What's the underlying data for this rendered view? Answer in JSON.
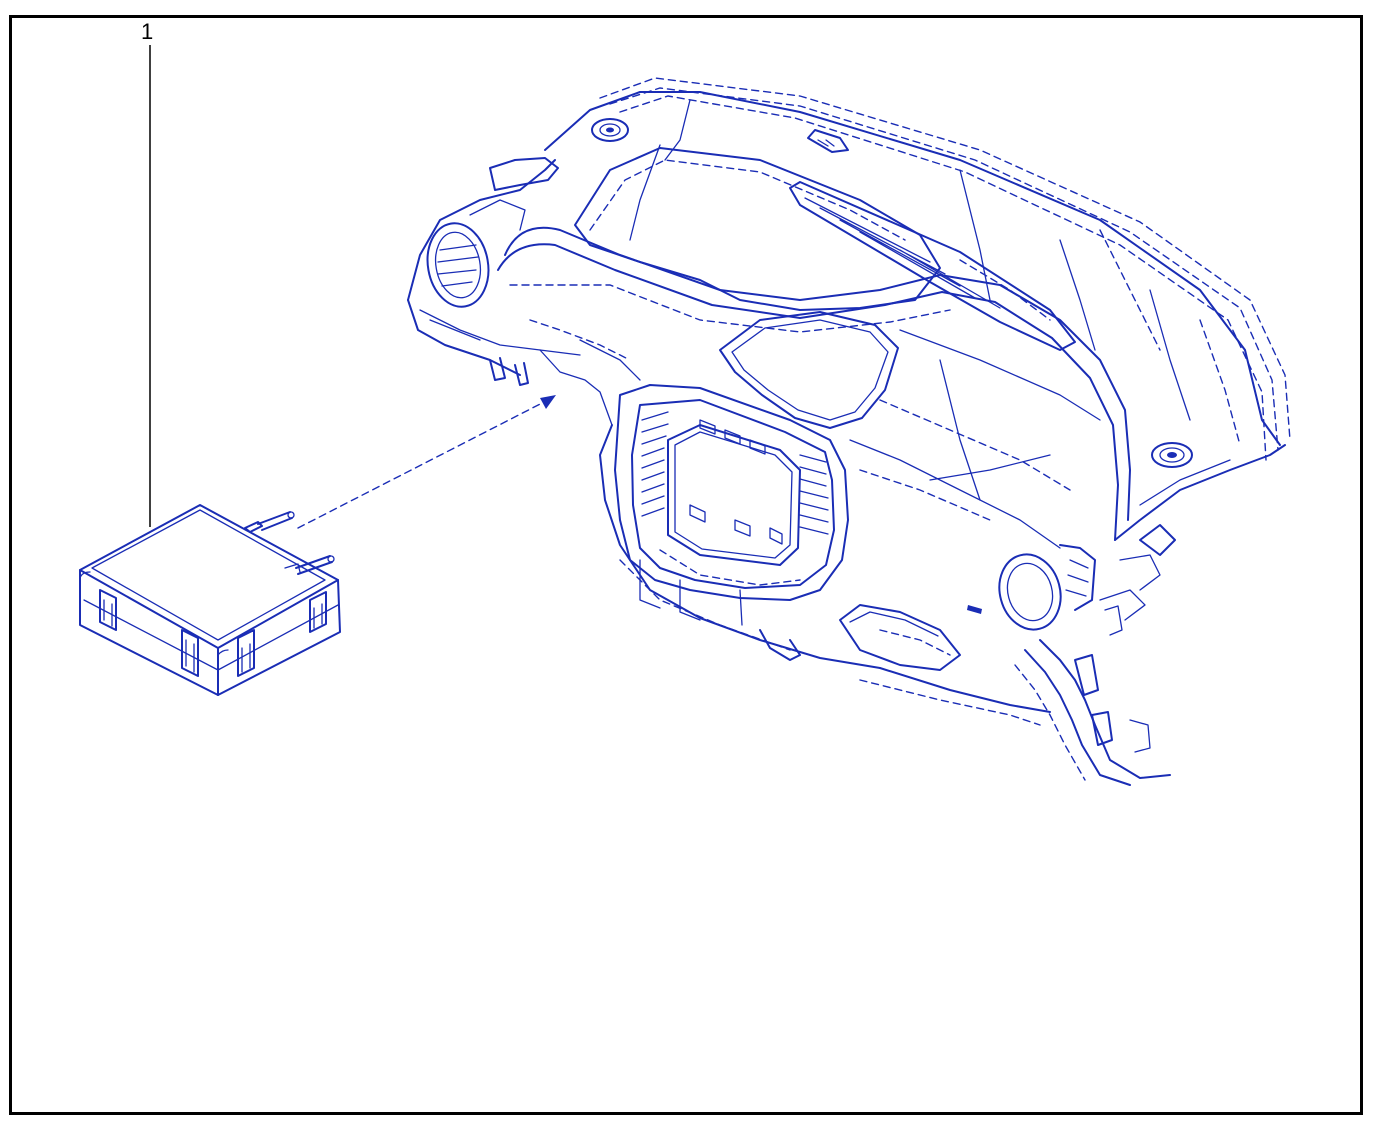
{
  "diagram": {
    "callouts": [
      {
        "number": "1",
        "part_icon": "airbag-module-icon"
      }
    ],
    "assembly_icon": "dashboard-assembly-icon",
    "colors": {
      "line": "#1a2db5",
      "frame": "#000000",
      "background": "#ffffff"
    }
  }
}
